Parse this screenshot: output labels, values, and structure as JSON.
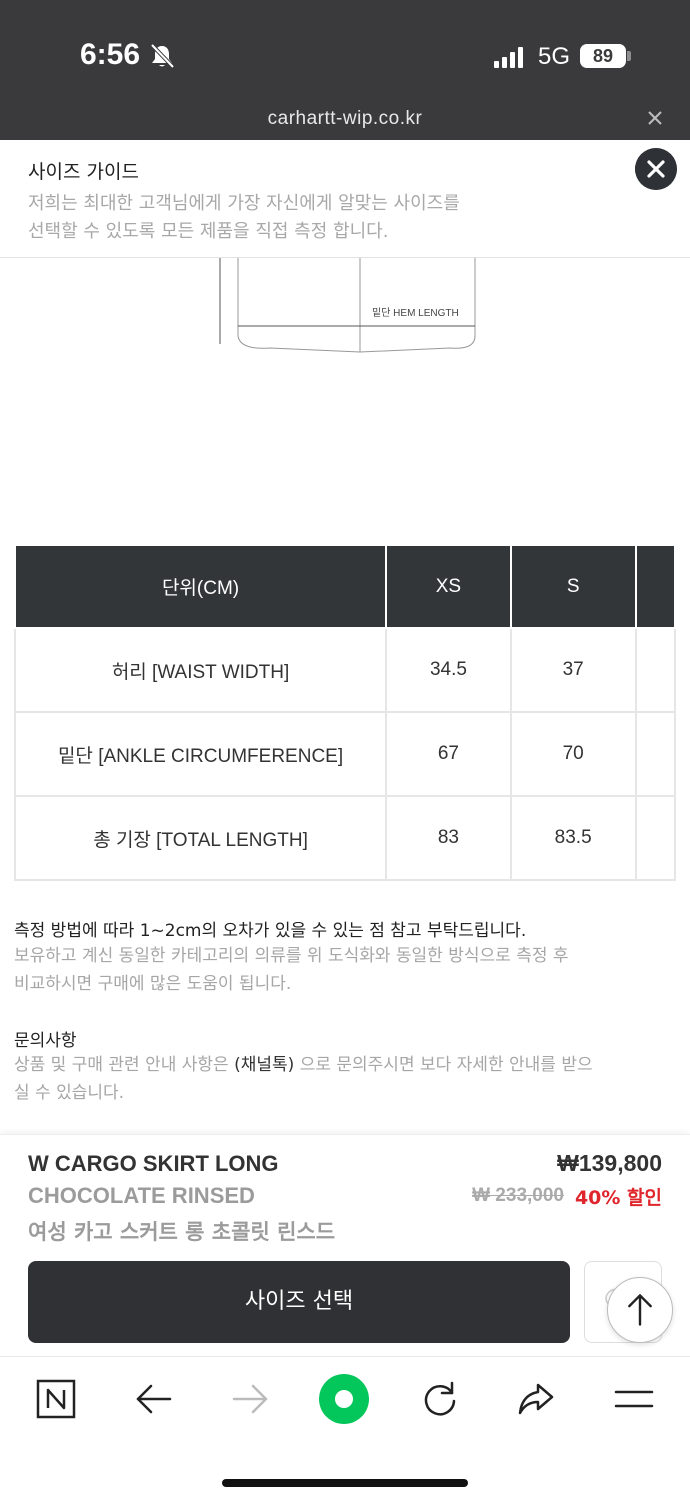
{
  "status": {
    "time": "6:56",
    "network": "5G",
    "battery": "89"
  },
  "browser": {
    "url": "carhartt-wip.co.kr"
  },
  "guide": {
    "title": "사이즈 가이드",
    "desc_line1": "저희는 최대한 고객님에게 가장 자신에게 알맞는 사이즈를",
    "desc_line2": "선택할 수 있도록 모든 제품을 직접 측정 합니다."
  },
  "diagram": {
    "label": "밑단 HEM LENGTH"
  },
  "table": {
    "headers": [
      "단위(CM)",
      "XS",
      "S",
      ""
    ],
    "rows": [
      {
        "label": "허리 [WAIST WIDTH]",
        "xs": "34.5",
        "s": "37"
      },
      {
        "label": "밑단 [ANKLE CIRCUMFERENCE]",
        "xs": "67",
        "s": "70"
      },
      {
        "label": "총 기장 [TOTAL LENGTH]",
        "xs": "83",
        "s": "83.5"
      }
    ]
  },
  "notes": {
    "main": "측정 방법에 따라 1~2cm의 오차가 있을 수 있는 점 참고 부탁드립니다.",
    "sub_line1": "보유하고 계신 동일한 카테고리의 의류를 위 도식화와 동일한 방식으로 측정 후",
    "sub_line2": "비교하시면 구매에 많은 도움이 됩니다.",
    "inquiry_title": "문의사항",
    "inquiry_pre": "상품 및 구매 관련 안내 사항은 ",
    "inquiry_channel": "(채널톡)",
    "inquiry_post": " 으로 문의주시면 보다 자세한 안내를 받으",
    "inquiry_line2": "실 수 있습니다."
  },
  "product": {
    "name": "W CARGO SKIRT LONG",
    "color": "CHOCOLATE RINSED",
    "name_kor": "여성 카고 스커트 롱 초콜릿 린스드",
    "price": "₩139,800",
    "original_price": "₩ 233,000",
    "discount": "40% 할인",
    "size_button": "사이즈 선택"
  },
  "icons": {
    "bell": "bell-slash-icon",
    "signal": "signal-icon",
    "close": "close-icon",
    "top": "arrow-up-icon",
    "wishlist": "heart-icon",
    "naver": "naver-n-icon",
    "back": "back-arrow-icon",
    "forward": "forward-arrow-icon",
    "green": "green-dot-icon",
    "reload": "reload-icon",
    "share": "share-icon",
    "menu": "menu-icon"
  },
  "colors": {
    "status_bg": "#3a3a3c",
    "header_dark": "#333639",
    "discount_red": "#e0262d",
    "green_button": "#03c75a"
  }
}
